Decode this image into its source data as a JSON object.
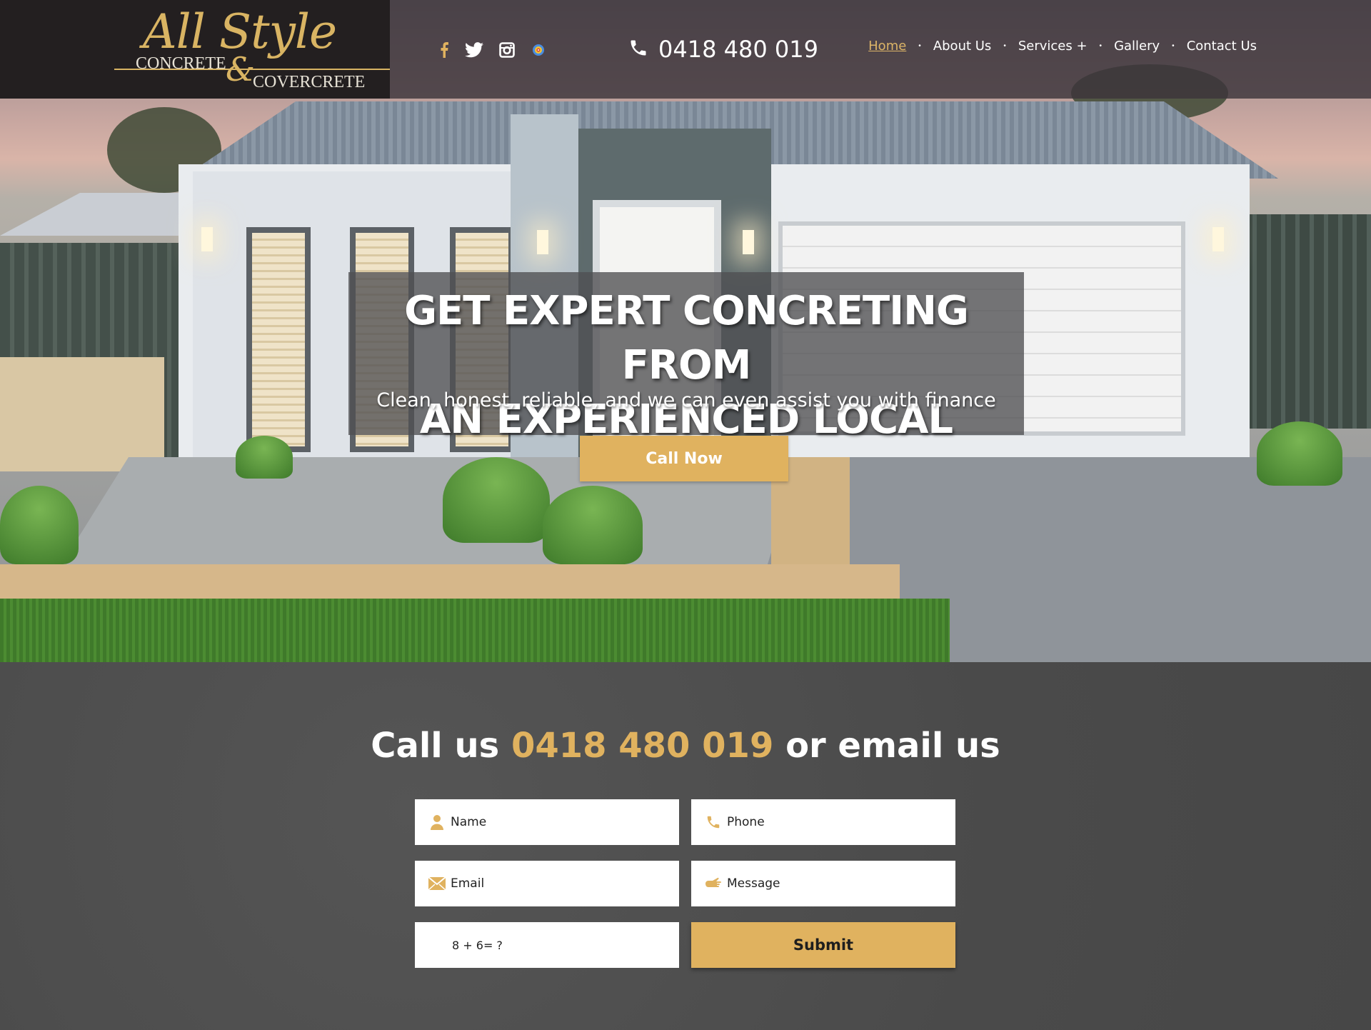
{
  "brand": {
    "logo_script": "All Style",
    "logo_line1": "CONCRETE",
    "logo_amp": "&",
    "logo_line2": "COVERCRETE",
    "accent_color": "#e0b25f",
    "header_bg": "#231f20"
  },
  "social": [
    {
      "name": "facebook-icon"
    },
    {
      "name": "twitter-icon"
    },
    {
      "name": "instagram-icon"
    },
    {
      "name": "google-plus-icon"
    }
  ],
  "header": {
    "phone_icon": "phone-icon",
    "phone": "0418 480 019"
  },
  "nav": {
    "items": [
      {
        "label": "Home",
        "active": true
      },
      {
        "label": "About Us"
      },
      {
        "label": "Services +"
      },
      {
        "label": "Gallery"
      },
      {
        "label": "Contact Us"
      }
    ],
    "separator": "•"
  },
  "hero": {
    "title_line1": "GET EXPERT CONCRETING FROM",
    "title_line2": "AN EXPERIENCED LOCAL",
    "subtitle": "Clean, honest, reliable, and we can even assist you with finance",
    "cta_label": "Call Now"
  },
  "contact": {
    "heading_prefix": "Call us",
    "heading_phone": "0418 480 019",
    "heading_suffix": "or email us",
    "fields": {
      "name_placeholder": "Name",
      "phone_placeholder": "Phone",
      "email_placeholder": "Email",
      "message_placeholder": "Message",
      "captcha_label": "8 + 6= ?"
    },
    "submit_label": "Submit"
  }
}
